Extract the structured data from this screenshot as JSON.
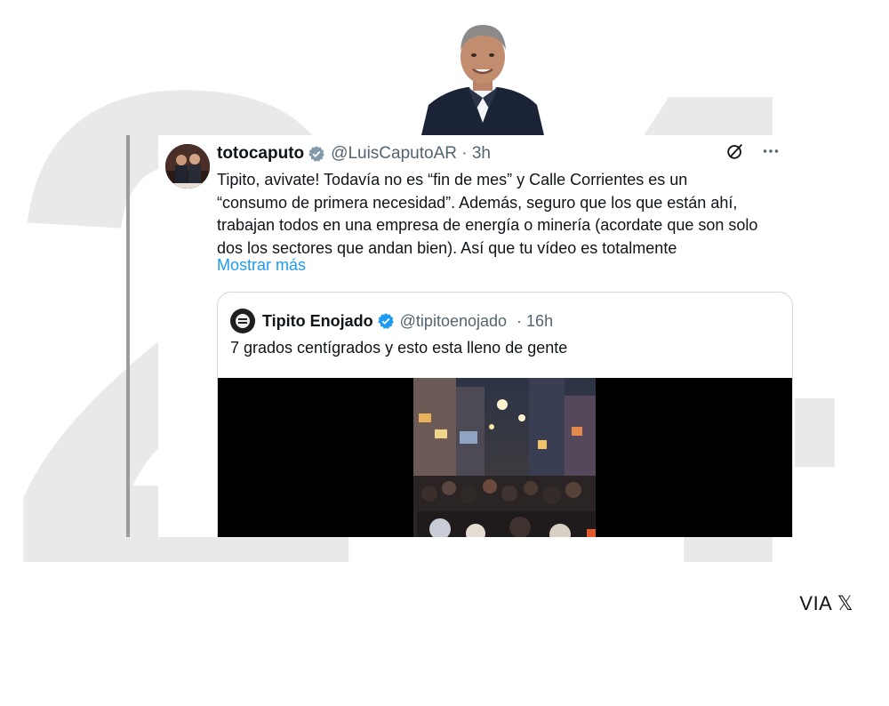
{
  "tweet": {
    "display_name": "totocaputo",
    "handle": "@LuisCaputoAR",
    "separator": "·",
    "time": "3h",
    "text_lines": [
      "Tipito, avivate! Todavía no es “fin de mes” y Calle Corrientes es un",
      "“consumo de primera necesidad”. Además, seguro que los que están ahí,",
      "trabajan todos en una empresa de energía o minería (acordate que son solo",
      "dos los sectores que andan bien). Así que tu vídeo es totalmente"
    ],
    "show_more": "Mostrar más",
    "icons": {
      "verified": "verified-badge-icon",
      "grok": "slash-circle-icon",
      "more": "more-dots-icon"
    }
  },
  "quote": {
    "display_name": "Tipito Enojado",
    "handle": "@tipitoenojado",
    "separator": "·",
    "time": "16h",
    "text": "7 grados centígrados y esto esta lleno de gente"
  },
  "footer": {
    "via_text": "VIA",
    "via_logo": "𝕏"
  },
  "colors": {
    "link": "#1d9bf0",
    "muted": "#536471",
    "verified": "#1d9bf0",
    "backdrop": "#e9e9e9"
  }
}
